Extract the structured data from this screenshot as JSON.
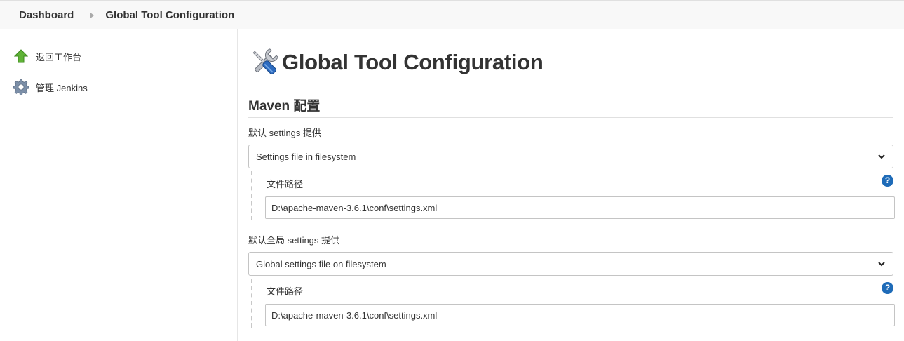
{
  "breadcrumb": {
    "items": [
      "Dashboard",
      "Global Tool Configuration"
    ]
  },
  "sidebar": {
    "items": [
      {
        "label": "返回工作台",
        "icon": "arrow-up-icon"
      },
      {
        "label": "管理 Jenkins",
        "icon": "gear-icon"
      }
    ]
  },
  "main": {
    "title": "Global Tool Configuration",
    "title_icon": "wrench-screwdriver-icon",
    "section": "Maven 配置",
    "settings": {
      "label": "默认 settings 提供",
      "selected": "Settings file in filesystem",
      "path_label": "文件路径",
      "path_value": "D:\\apache-maven-3.6.1\\conf\\settings.xml"
    },
    "global_settings": {
      "label": "默认全局 settings 提供",
      "selected": "Global settings file on filesystem",
      "path_label": "文件路径",
      "path_value": "D:\\apache-maven-3.6.1\\conf\\settings.xml"
    }
  },
  "colors": {
    "help_icon": "#1e6bb8",
    "arrow_green": "#5fb336"
  }
}
